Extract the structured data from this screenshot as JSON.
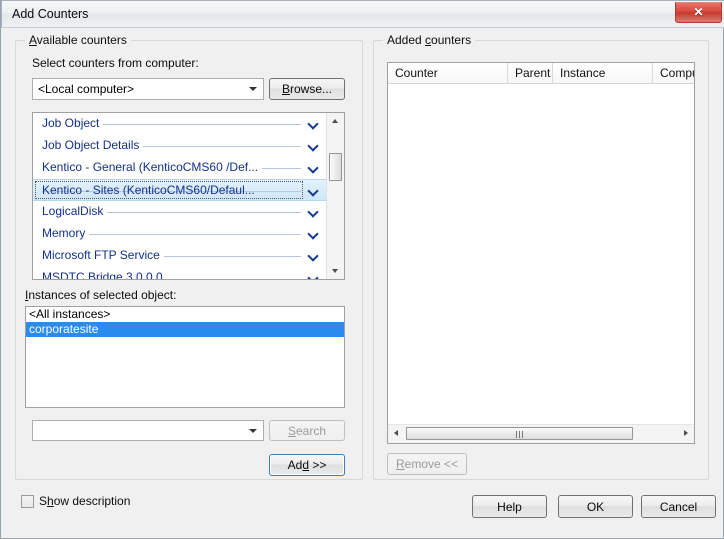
{
  "window": {
    "title": "Add Counters",
    "close_icon": "close-icon"
  },
  "available": {
    "legend_pre": "A",
    "legend": "Available counters",
    "computer_label": "Select counters from computer:",
    "computer_value": "<Local computer>",
    "browse_label": "Browse...",
    "counters": [
      {
        "name": "Job Object",
        "selected": false
      },
      {
        "name": "Job Object Details",
        "selected": false
      },
      {
        "name": "Kentico - General (KenticoCMS60 /Def...",
        "selected": false
      },
      {
        "name": "Kentico - Sites (KenticoCMS60/Defaul...",
        "selected": true
      },
      {
        "name": "LogicalDisk",
        "selected": false
      },
      {
        "name": "Memory",
        "selected": false
      },
      {
        "name": "Microsoft FTP Service",
        "selected": false
      },
      {
        "name": "MSDTC Bridge 3.0.0.0",
        "selected": false
      }
    ],
    "instances_label": "Instances of selected object:",
    "instances": [
      {
        "name": "<All instances>",
        "selected": false
      },
      {
        "name": "corporatesite",
        "selected": true
      }
    ],
    "search_value": "",
    "search_label": "Search",
    "add_label": "Add >>"
  },
  "added": {
    "legend": "Added counters",
    "columns": [
      "Counter",
      "Parent",
      "Instance",
      "Compu"
    ],
    "rows": [],
    "remove_label": "Remove <<"
  },
  "footer": {
    "show_description_label": "Show description",
    "help_label": "Help",
    "ok_label": "OK",
    "cancel_label": "Cancel"
  },
  "colors": {
    "selection_blue": "#2a8bef",
    "counter_text": "#13308b",
    "close_red": "#d9473c"
  }
}
